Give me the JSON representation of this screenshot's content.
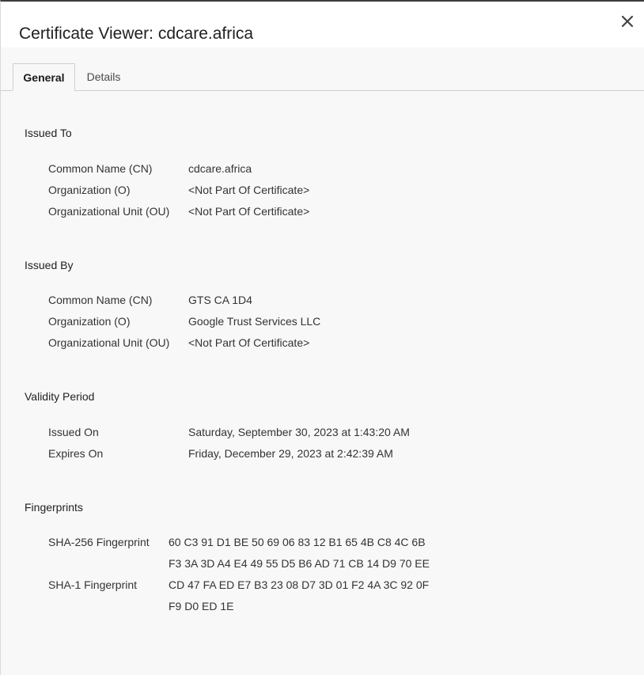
{
  "dialog": {
    "title": "Certificate Viewer: cdcare.africa",
    "close_icon": "close-icon"
  },
  "tabs": [
    {
      "label": "General",
      "active": true
    },
    {
      "label": "Details",
      "active": false
    }
  ],
  "issued_to": {
    "heading": "Issued To",
    "rows": [
      {
        "label": "Common Name (CN)",
        "value": "cdcare.africa"
      },
      {
        "label": "Organization (O)",
        "value": "<Not Part Of Certificate>"
      },
      {
        "label": "Organizational Unit (OU)",
        "value": "<Not Part Of Certificate>"
      }
    ]
  },
  "issued_by": {
    "heading": "Issued By",
    "rows": [
      {
        "label": "Common Name (CN)",
        "value": "GTS CA 1D4"
      },
      {
        "label": "Organization (O)",
        "value": "Google Trust Services LLC"
      },
      {
        "label": "Organizational Unit (OU)",
        "value": "<Not Part Of Certificate>"
      }
    ]
  },
  "validity": {
    "heading": "Validity Period",
    "rows": [
      {
        "label": "Issued On",
        "value": "Saturday, September 30, 2023 at 1:43:20 AM"
      },
      {
        "label": "Expires On",
        "value": "Friday, December 29, 2023 at 2:42:39 AM"
      }
    ]
  },
  "fingerprints": {
    "heading": "Fingerprints",
    "sha256": {
      "label": "SHA-256 Fingerprint",
      "line1": "60 C3 91 D1 BE 50 69 06 83 12 B1 65 4B C8 4C 6B",
      "line2": "F3 3A 3D A4 E4 49 55 D5 B6 AD 71 CB 14 D9 70 EE"
    },
    "sha1": {
      "label": "SHA-1 Fingerprint",
      "line1": "CD 47 FA ED E7 B3 23 08 D7 3D 01 F2 4A 3C 92 0F",
      "line2": "F9 D0 ED 1E"
    }
  }
}
